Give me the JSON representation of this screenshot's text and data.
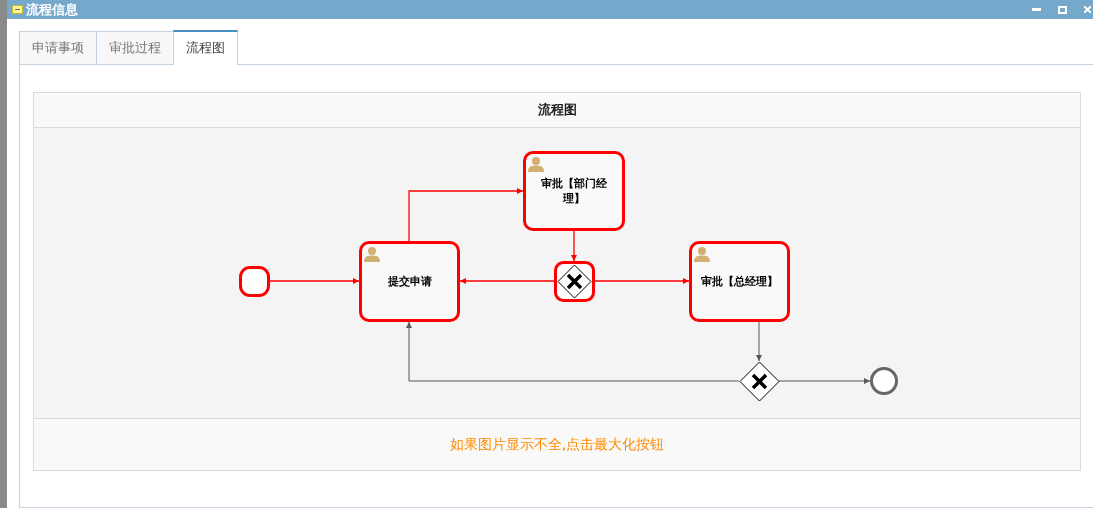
{
  "window": {
    "title": "流程信息"
  },
  "tabs": [
    {
      "label": "申请事项",
      "selected": false
    },
    {
      "label": "审批过程",
      "selected": false
    },
    {
      "label": "流程图",
      "selected": true
    }
  ],
  "panel": {
    "title": "流程图",
    "hint": "如果图片显示不全,点击最大化按钮"
  },
  "diagram": {
    "nodes": [
      {
        "kind": "start",
        "highlighted": true
      },
      {
        "kind": "task",
        "label": "提交申请",
        "highlighted": true
      },
      {
        "kind": "task",
        "label": "审批【部门经理】",
        "highlighted": true
      },
      {
        "kind": "gateway",
        "highlighted": true
      },
      {
        "kind": "task",
        "label": "审批【总经理】",
        "highlighted": true
      },
      {
        "kind": "gateway",
        "highlighted": false
      },
      {
        "kind": "end",
        "highlighted": false
      }
    ],
    "edges": [
      {
        "highlighted": true
      },
      {
        "highlighted": true
      },
      {
        "highlighted": true
      },
      {
        "highlighted": true
      },
      {
        "highlighted": true
      },
      {
        "highlighted": false
      },
      {
        "highlighted": false
      },
      {
        "highlighted": false
      }
    ]
  }
}
